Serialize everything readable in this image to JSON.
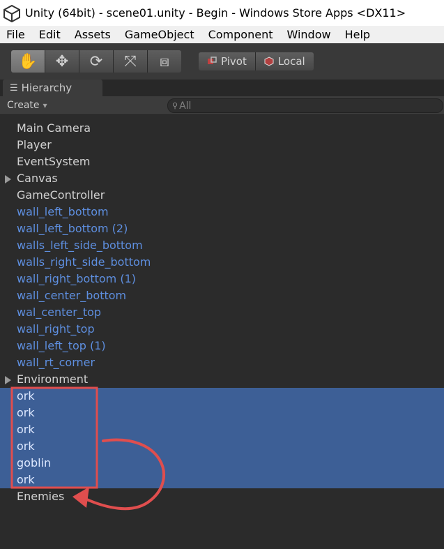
{
  "window": {
    "title": "Unity (64bit) - scene01.unity - Begin - Windows Store Apps <DX11>"
  },
  "menu": [
    "File",
    "Edit",
    "Assets",
    "GameObject",
    "Component",
    "Window",
    "Help"
  ],
  "toolbar": {
    "tools": [
      {
        "name": "hand-tool",
        "icon": "hand-icon",
        "glyph": "✋",
        "active": true
      },
      {
        "name": "move-tool",
        "icon": "move-icon",
        "glyph": "✥",
        "active": false
      },
      {
        "name": "rotate-tool",
        "icon": "rotate-icon",
        "glyph": "⟳",
        "active": false
      },
      {
        "name": "scale-tool",
        "icon": "scale-icon",
        "glyph": "⤧",
        "active": false
      },
      {
        "name": "rect-tool",
        "icon": "rect-icon",
        "glyph": "⧈",
        "active": false
      }
    ],
    "pivot_label": "Pivot",
    "local_label": "Local"
  },
  "hierarchy": {
    "tab_label": "Hierarchy",
    "create_label": "Create",
    "search_placeholder": "All",
    "items": [
      {
        "label": "Main Camera",
        "style": "white",
        "expand": false
      },
      {
        "label": "Player",
        "style": "white",
        "expand": false
      },
      {
        "label": "EventSystem",
        "style": "white",
        "expand": false
      },
      {
        "label": "Canvas",
        "style": "white",
        "expand": true
      },
      {
        "label": "GameController",
        "style": "white",
        "expand": false
      },
      {
        "label": "wall_left_bottom",
        "style": "blue",
        "expand": false
      },
      {
        "label": "wall_left_bottom (2)",
        "style": "blue",
        "expand": false
      },
      {
        "label": "walls_left_side_bottom",
        "style": "blue",
        "expand": false
      },
      {
        "label": "walls_right_side_bottom",
        "style": "blue",
        "expand": false
      },
      {
        "label": "wall_right_bottom (1)",
        "style": "blue",
        "expand": false
      },
      {
        "label": "wall_center_bottom",
        "style": "blue",
        "expand": false
      },
      {
        "label": "wal_center_top",
        "style": "blue",
        "expand": false
      },
      {
        "label": "wall_right_top",
        "style": "blue",
        "expand": false
      },
      {
        "label": "wall_left_top (1)",
        "style": "blue",
        "expand": false
      },
      {
        "label": "wall_rt_corner",
        "style": "blue",
        "expand": false
      },
      {
        "label": "Environment",
        "style": "white",
        "expand": true
      },
      {
        "label": "ork",
        "style": "sel",
        "expand": false
      },
      {
        "label": "ork",
        "style": "sel",
        "expand": false
      },
      {
        "label": "ork",
        "style": "sel",
        "expand": false
      },
      {
        "label": "ork",
        "style": "sel",
        "expand": false
      },
      {
        "label": "goblin",
        "style": "sel",
        "expand": false
      },
      {
        "label": "ork",
        "style": "sel",
        "expand": false
      },
      {
        "label": "Enemies",
        "style": "white",
        "expand": false
      }
    ]
  },
  "colors": {
    "selection": "#3d5f96",
    "prefab_text": "#5e8fe0",
    "annotation": "#e04e4e"
  }
}
